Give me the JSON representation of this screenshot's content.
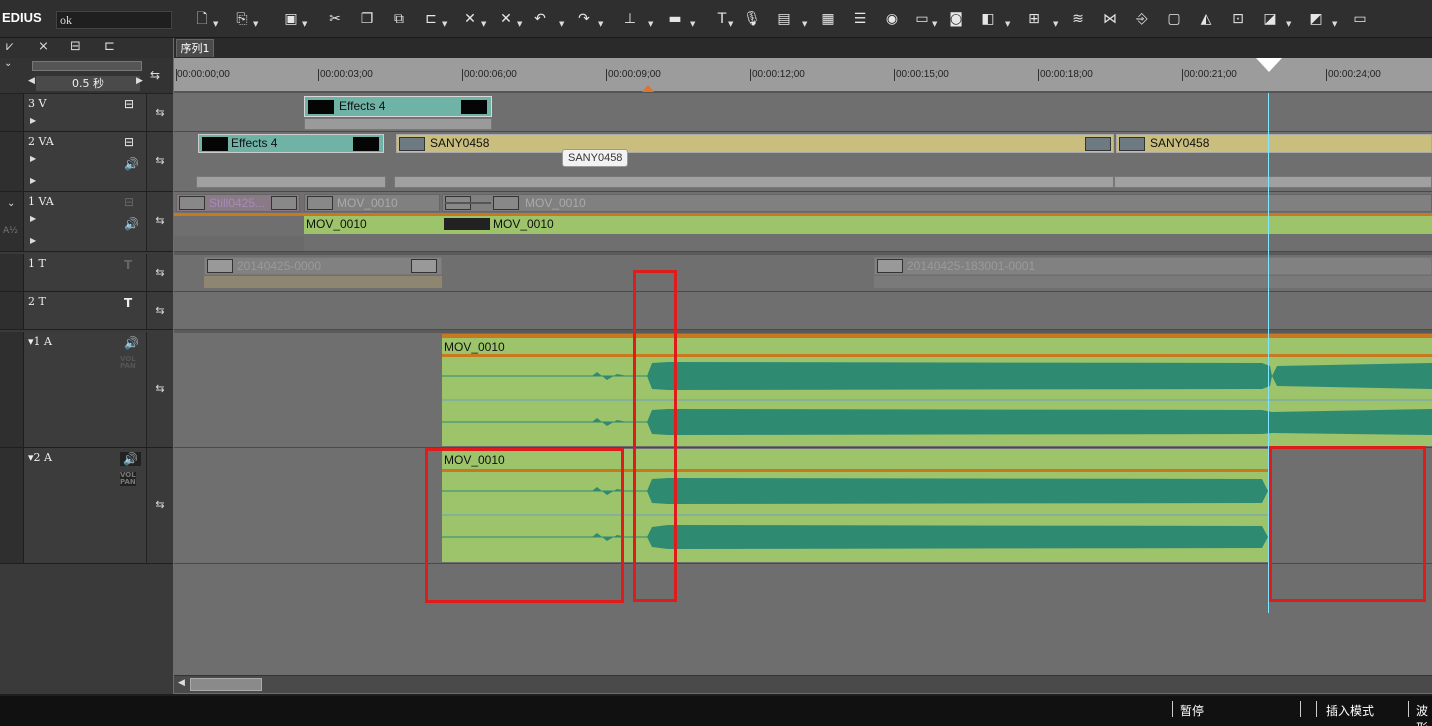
{
  "app": {
    "logo": "EDIUS",
    "project_name": "ok"
  },
  "toolbar": {
    "icons": [
      "new-sequence-icon",
      "open-icon",
      "save-icon",
      "cut-icon",
      "copy-icon",
      "paste-icon",
      "split-icon",
      "ripple-delete-icon",
      "delete-icon",
      "undo-icon",
      "redo-icon",
      "marker-icon",
      "sync-icon",
      "title-icon",
      "mic-icon",
      "render-icon",
      "layout-icon",
      "mixer-icon",
      "color-wheel-icon",
      "monitor-icon",
      "camera-icon",
      "transition-icon",
      "multicam-icon",
      "waveform-icon",
      "snap-icon",
      "track-link-icon",
      "bin-icon",
      "effects-icon",
      "capture-icon",
      "export-icon",
      "tape-icon",
      "settings-icon"
    ]
  },
  "left_panel": {
    "zoom_label": "0.5 秒",
    "tracks": [
      {
        "name": "3 V",
        "kind": "video"
      },
      {
        "name": "2 VA",
        "kind": "video-audio"
      },
      {
        "name": "1 VA",
        "kind": "video-audio"
      },
      {
        "name": "1 T",
        "kind": "title"
      },
      {
        "name": "2 T",
        "kind": "title"
      },
      {
        "name": "1 A",
        "kind": "audio",
        "vol_label": "VOL",
        "pan_label": "PAN"
      },
      {
        "name": "2 A",
        "kind": "audio",
        "vol_label": "VOL",
        "pan_label": "PAN"
      }
    ]
  },
  "timeline": {
    "sequence_tab": "序列1",
    "ruler": [
      "00:00:00;00",
      "00:00:03;00",
      "00:00:06;00",
      "00:00:09;00",
      "00:00:12;00",
      "00:00:15;00",
      "00:00:18;00",
      "00:00:21;00",
      "00:00:24;00"
    ],
    "clips": {
      "v3_effects": "Effects 4",
      "v2_effects": "Effects 4",
      "v2_sany_a": "SANY0458",
      "v2_sany_b": "SANY0458",
      "v1_still": "Still0425...",
      "v1_mov_top_a": "MOV_0010",
      "v1_mov_top_b": "MOV_0010",
      "v1_mov_a": "MOV_0010",
      "v1_mov_b": "MOV_0010",
      "t1_title_a": "20140425-0000",
      "t1_title_b": "20140425-183001-0001",
      "a1_clip": "MOV_0010",
      "a2_clip": "MOV_0010"
    },
    "tooltip": "SANY0458"
  },
  "status": {
    "pause": "暂停",
    "mode": "插入模式",
    "waveform": "波形"
  },
  "colors": {
    "audio_clip": "#9dc46b",
    "waveform": "#2f8a72",
    "effects_clip": "#6fb3a6",
    "video_clip": "#c9be7d",
    "redbox": "#e01b1b"
  }
}
